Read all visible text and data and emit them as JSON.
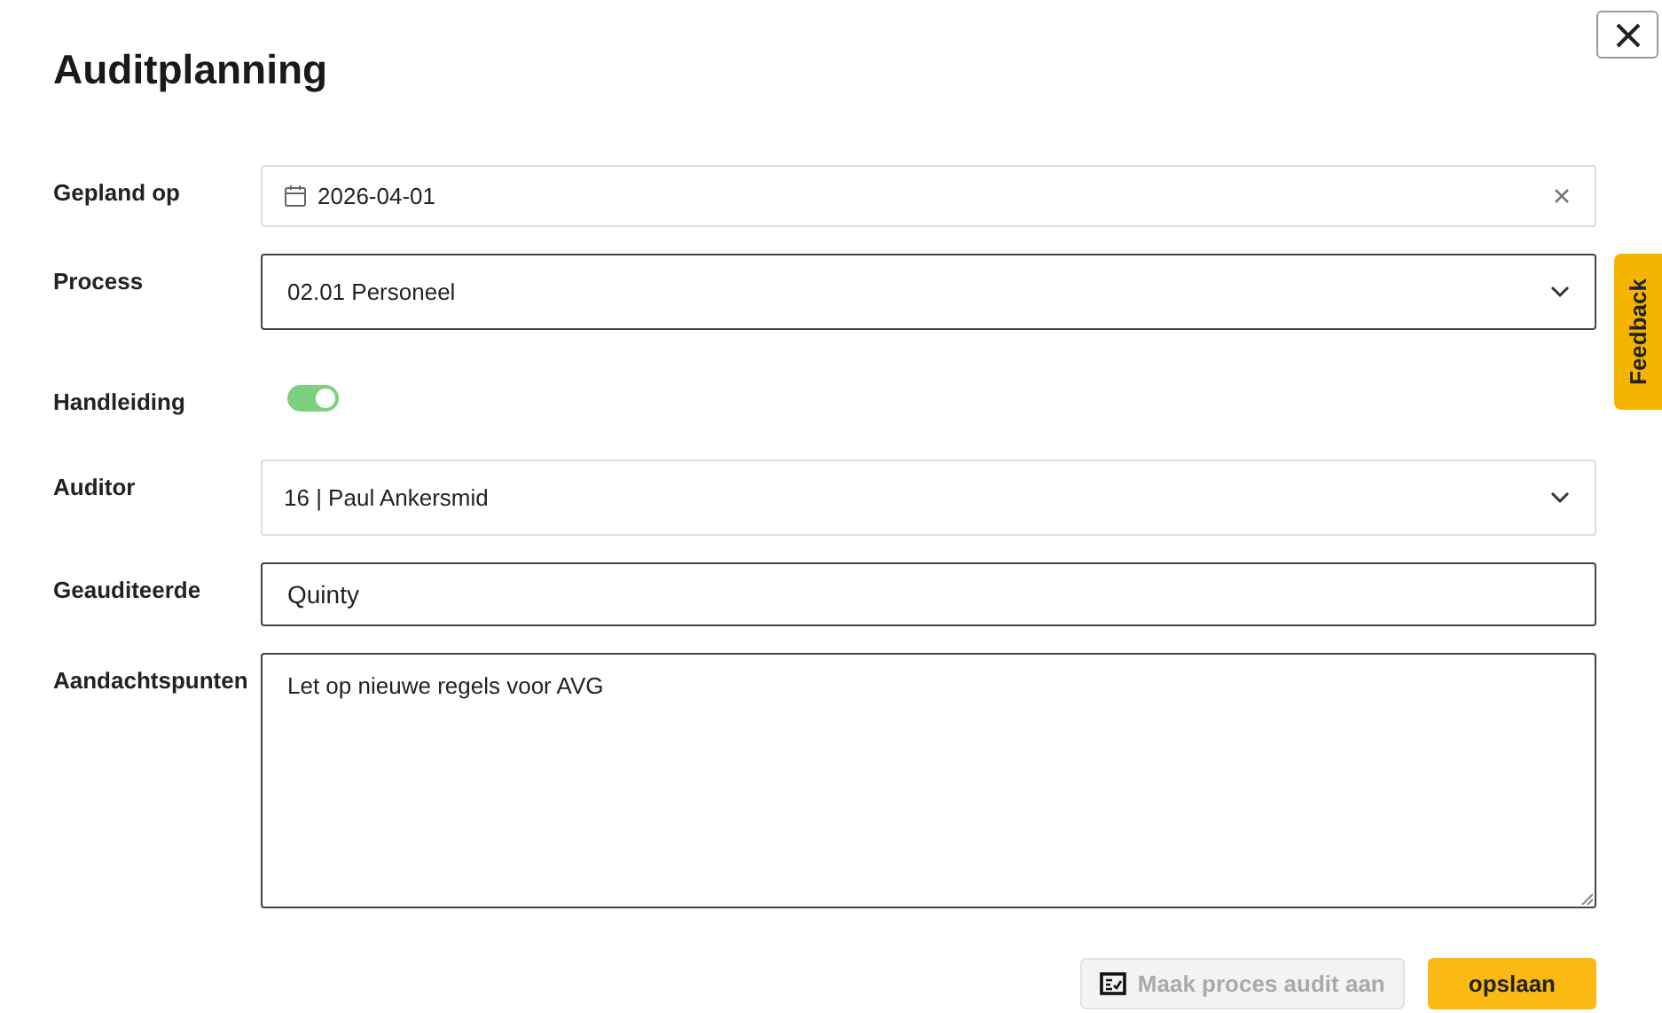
{
  "title": "Auditplanning",
  "feedback": {
    "label": "Feedback"
  },
  "fields": [
    {
      "kind": "date",
      "label": "Gepland op",
      "value": "2026-04-01",
      "disabled": true
    },
    {
      "kind": "select",
      "label": "Process",
      "value": "02.01 Personeel",
      "disabled": false
    },
    {
      "kind": "toggle",
      "label": "Handleiding",
      "on": true
    },
    {
      "kind": "select",
      "label": "Auditor",
      "value": "16 | Paul Ankersmid",
      "disabled": true
    },
    {
      "kind": "text",
      "label": "Geauditeerde",
      "value": "Quinty",
      "disabled": false
    },
    {
      "kind": "textarea",
      "label": "Aandachtspunten",
      "value": "Let op nieuwe regels voor AVG",
      "disabled": false
    }
  ],
  "buttons": [
    {
      "kind": "secondary",
      "label": "Maak proces audit aan",
      "disabled": true
    },
    {
      "kind": "primary",
      "label": "opslaan",
      "disabled": false
    }
  ]
}
